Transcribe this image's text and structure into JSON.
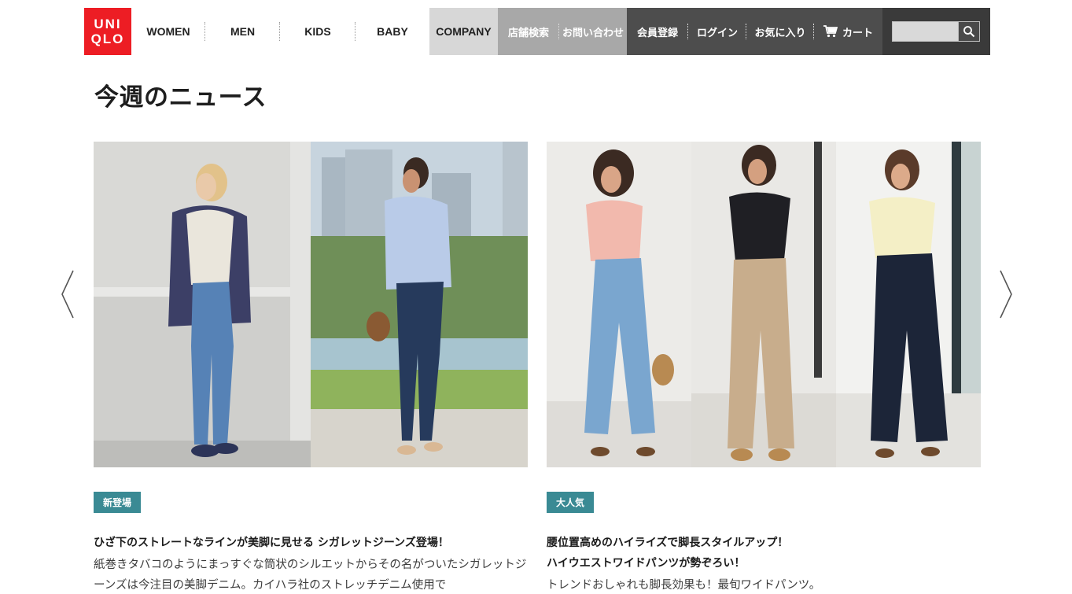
{
  "header": {
    "logo_line1": "UNI",
    "logo_line2": "QLO",
    "nav": [
      "WOMEN",
      "MEN",
      "KIDS",
      "BABY"
    ],
    "company": "COMPANY",
    "store_search": "店舗検索",
    "contact": "お問い合わせ",
    "register": "会員登録",
    "login": "ログイン",
    "favorites": "お気に入り",
    "cart": "カート",
    "search_value": ""
  },
  "page_title": "今週のニュース",
  "cards": [
    {
      "badge": "新登場",
      "headline": "ひざ下のストレートなラインが美脚に見せる シガレットジーンズ登場！",
      "body": "紙巻きタバコのようにまっすぐな筒状のシルエットからその名がついたシガレットジーンズは今注目の美脚デニム。カイハラ社のストレッチデニム使用で"
    },
    {
      "badge": "大人気",
      "headline": "腰位置高めのハイライズで脚長スタイルアップ！\nハイウエストワイドパンツが勢ぞろい！",
      "body": "トレンドおしゃれも脚長効果も！最旬ワイドパンツ。"
    }
  ],
  "colors": {
    "brand_red": "#ed1d24",
    "badge_teal": "#3a8a94",
    "header_dark": "#4d4d4d",
    "header_mid": "#a8a8a8",
    "header_light": "#d7d7d7"
  },
  "icons": {
    "cart": "cart-icon",
    "search": "search-icon",
    "prev": "chevron-left-icon",
    "next": "chevron-right-icon"
  }
}
